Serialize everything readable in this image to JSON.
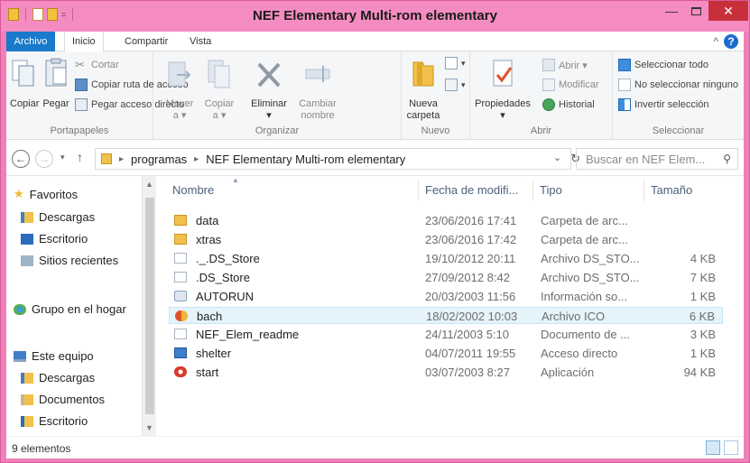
{
  "window": {
    "title": "NEF Elementary Multi-rom elementary",
    "min_glyph": "—",
    "close_glyph": "✕"
  },
  "ribbon_tabs": [
    "Archivo",
    "Inicio",
    "Compartir",
    "Vista"
  ],
  "ribbon": {
    "clipboard": {
      "copy": "Copiar",
      "paste": "Pegar",
      "cut": "Cortar",
      "copy_path": "Copiar ruta de acceso",
      "paste_shortcut": "Pegar acceso directo",
      "label": "Portapapeles"
    },
    "organize": {
      "move_line1": "Mover",
      "move_line2": "a ▾",
      "copy_line1": "Copiar",
      "copy_line2": "a ▾",
      "delete_line1": "Eliminar",
      "delete_line2": "▾",
      "rename_line1": "Cambiar",
      "rename_line2": "nombre",
      "label": "Organizar"
    },
    "new": {
      "folder_line1": "Nueva",
      "folder_line2": "carpeta",
      "label": "Nuevo"
    },
    "open": {
      "properties": "Propiedades",
      "properties_drop": "▾",
      "open": "Abrir ▾",
      "modify": "Modificar",
      "history": "Historial",
      "label": "Abrir"
    },
    "select": {
      "select_all": "Seleccionar todo",
      "select_none": "No seleccionar ninguno",
      "invert": "Invertir selección",
      "label": "Seleccionar"
    }
  },
  "address": {
    "path": [
      "programas",
      "NEF Elementary Multi-rom elementary"
    ],
    "search_placeholder": "Buscar en NEF Elem..."
  },
  "nav_pane": [
    {
      "label": "Favoritos",
      "icon": "star-icon"
    },
    {
      "label": "Descargas",
      "icon": "downloads-folder-icon"
    },
    {
      "label": "Escritorio",
      "icon": "desktop-icon"
    },
    {
      "label": "Sitios recientes",
      "icon": "recent-places-icon"
    },
    {
      "label": "Grupo en el hogar",
      "icon": "homegroup-icon"
    },
    {
      "label": "Este equipo",
      "icon": "computer-icon"
    },
    {
      "label": "Descargas",
      "icon": "downloads-folder-icon"
    },
    {
      "label": "Documentos",
      "icon": "documents-folder-icon"
    },
    {
      "label": "Escritorio",
      "icon": "desktop-folder-icon"
    }
  ],
  "columns": {
    "name": "Nombre",
    "date": "Fecha de modifi...",
    "type": "Tipo",
    "size": "Tamaño"
  },
  "files": [
    {
      "name": "data",
      "date": "23/06/2016 17:41",
      "type": "Carpeta de arc...",
      "size": "",
      "icon": "folder-icon"
    },
    {
      "name": "xtras",
      "date": "23/06/2016 17:42",
      "type": "Carpeta de arc...",
      "size": "",
      "icon": "folder-icon"
    },
    {
      "name": "._.DS_Store",
      "date": "19/10/2012 20:11",
      "type": "Archivo DS_STO...",
      "size": "4 KB",
      "icon": "file-icon"
    },
    {
      "name": ".DS_Store",
      "date": "27/09/2012 8:42",
      "type": "Archivo DS_STO...",
      "size": "7 KB",
      "icon": "file-icon"
    },
    {
      "name": "AUTORUN",
      "date": "20/03/2003 11:56",
      "type": "Información so...",
      "size": "1 KB",
      "icon": "autorun-icon"
    },
    {
      "name": "bach",
      "date": "18/02/2002 10:03",
      "type": "Archivo ICO",
      "size": "6 KB",
      "icon": "ico-file-icon"
    },
    {
      "name": "NEF_Elem_readme",
      "date": "24/11/2003 5:10",
      "type": "Documento de ...",
      "size": "3 KB",
      "icon": "file-icon"
    },
    {
      "name": "shelter",
      "date": "04/07/2011 19:55",
      "type": "Acceso directo",
      "size": "1 KB",
      "icon": "shortcut-icon"
    },
    {
      "name": "start",
      "date": "03/07/2003 8:27",
      "type": "Aplicación",
      "size": "94 KB",
      "icon": "application-icon"
    }
  ],
  "selected_file": "bach",
  "status": {
    "count": "9 elementos"
  },
  "colors": {
    "accent": "#1979ca",
    "titlebar": "#f48cc2",
    "selection": "#e5f3fb"
  }
}
